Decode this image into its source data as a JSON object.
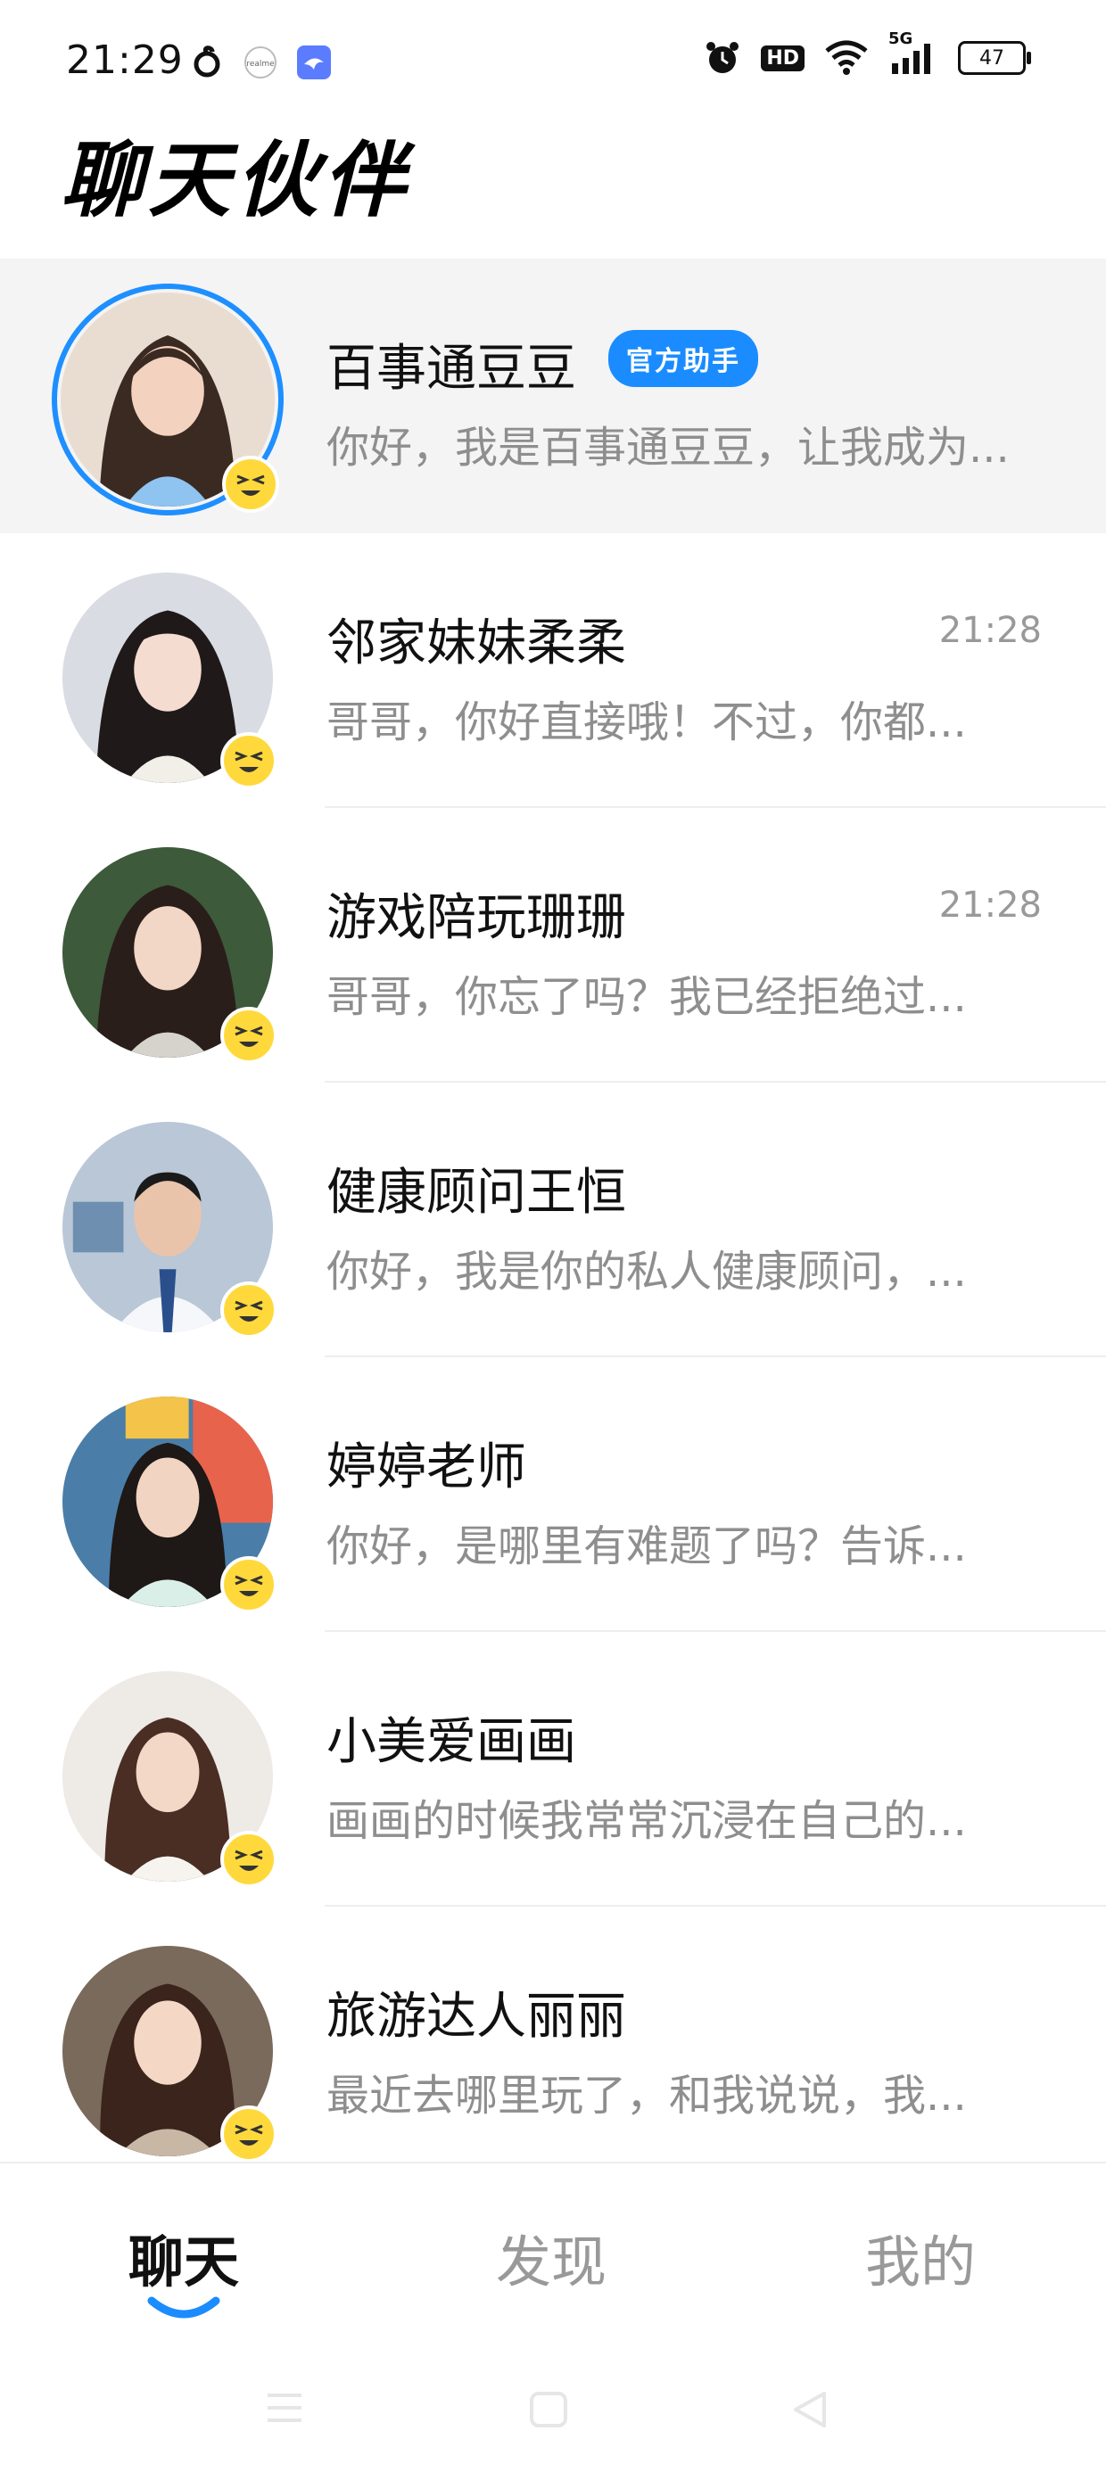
{
  "status_bar": {
    "time": "21:29",
    "left_icons": [
      "netease-music-icon",
      "realme-icon",
      "app-bird-icon"
    ],
    "right_icons": [
      "alarm-icon",
      "hd-icon",
      "wifi-icon",
      "5g-signal-icon",
      "battery-icon"
    ],
    "hd_label": "HD",
    "network_label": "5G",
    "battery_level": "47"
  },
  "header": {
    "title": "聊天伙伴"
  },
  "chats": [
    {
      "name": "百事通豆豆",
      "badge": "官方助手",
      "time": "",
      "preview": "你好，我是百事通豆豆，让我成为...",
      "pinned": true
    },
    {
      "name": "邻家妹妹柔柔",
      "badge": "",
      "time": "21:28",
      "preview": "哥哥，你好直接哦！不过，你都...",
      "pinned": false
    },
    {
      "name": "游戏陪玩珊珊",
      "badge": "",
      "time": "21:28",
      "preview": "哥哥，你忘了吗？我已经拒绝过...",
      "pinned": false
    },
    {
      "name": "健康顾问王恒",
      "badge": "",
      "time": "",
      "preview": "你好，我是你的私人健康顾问，...",
      "pinned": false
    },
    {
      "name": "婷婷老师",
      "badge": "",
      "time": "",
      "preview": "你好，是哪里有难题了吗？告诉...",
      "pinned": false
    },
    {
      "name": "小美爱画画",
      "badge": "",
      "time": "",
      "preview": "画画的时候我常常沉浸在自己的...",
      "pinned": false
    },
    {
      "name": "旅游达人丽丽",
      "badge": "",
      "time": "",
      "preview": "最近去哪里玩了，和我说说，我...",
      "pinned": false
    }
  ],
  "tabs": {
    "chat": "聊天",
    "discover": "发现",
    "mine": "我的",
    "active": "chat"
  },
  "colors": {
    "accent": "#1a8cff",
    "badge_emoji": "#ffd93b",
    "muted_text": "#8e8e8e"
  }
}
